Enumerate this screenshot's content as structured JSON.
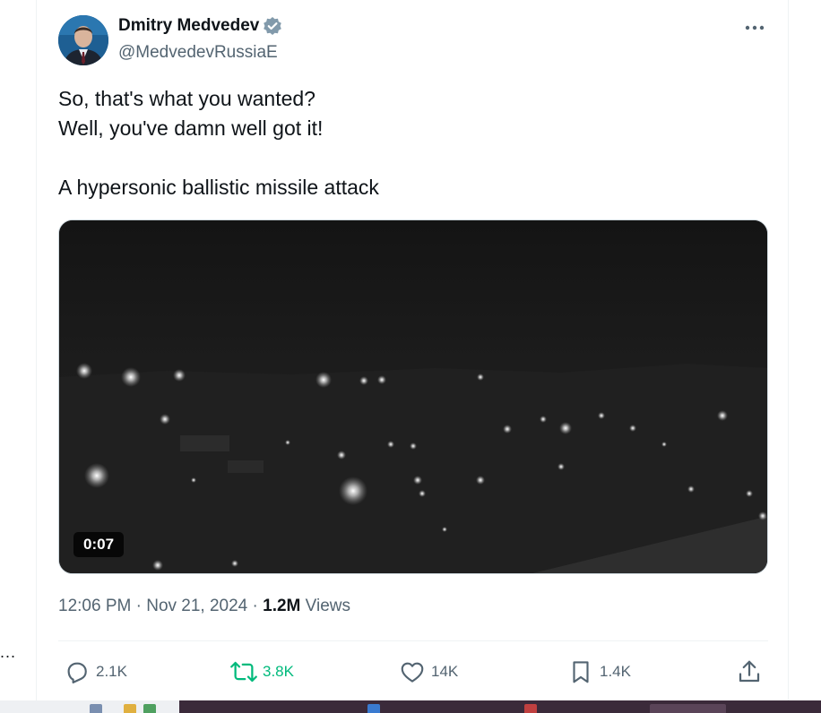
{
  "tweet": {
    "author": {
      "display_name": "Dmitry Medvedev",
      "handle": "@MedvedevRussiaE",
      "verified": true
    },
    "text_lines": [
      "So, that's what you wanted?",
      "Well, you've damn well got it!",
      "",
      "A hypersonic ballistic missile attack"
    ],
    "media": {
      "type": "video",
      "duration": "0:07"
    },
    "meta": {
      "time": "12:06 PM",
      "separator": "·",
      "date": "Nov 21, 2024",
      "views_count": "1.2M",
      "views_label": "Views"
    },
    "actions": {
      "replies": "2.1K",
      "retweets": "3.8K",
      "likes": "14K",
      "bookmarks": "1.4K"
    }
  },
  "left_column": {
    "ellipsis": "..."
  },
  "colors": {
    "text_primary": "#0f1419",
    "text_secondary": "#536471",
    "verified": "#829aab",
    "retweet_green": "#00ba7c",
    "divider": "#eff3f4"
  },
  "icons": [
    "verified-badge-icon",
    "more-options-icon",
    "reply-icon",
    "retweet-icon",
    "like-icon",
    "bookmark-icon",
    "share-icon"
  ]
}
